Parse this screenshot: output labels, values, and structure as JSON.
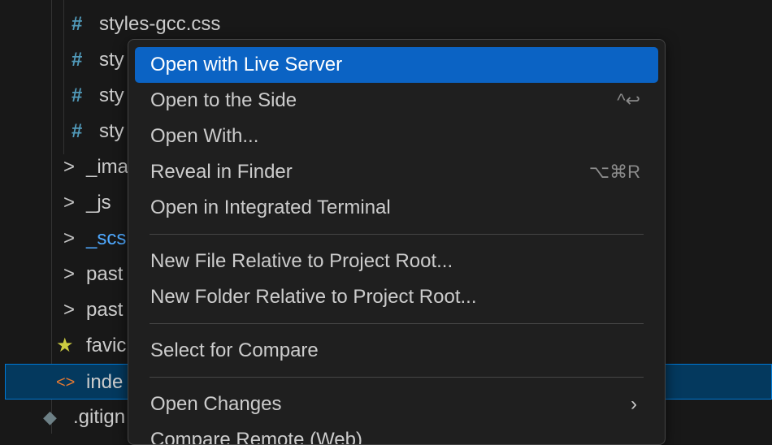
{
  "explorer": {
    "rows": [
      {
        "icon": "#",
        "label": "styles-gcc.css"
      },
      {
        "icon": "#",
        "label": "sty"
      },
      {
        "icon": "#",
        "label": "sty"
      },
      {
        "icon": "#",
        "label": "sty"
      },
      {
        "icon": ">",
        "label": "_ima"
      },
      {
        "icon": ">",
        "label": "_js"
      },
      {
        "icon": ">",
        "label": "_scs"
      },
      {
        "icon": ">",
        "label": "past"
      },
      {
        "icon": ">",
        "label": "past"
      },
      {
        "icon": "★",
        "label": "favic"
      },
      {
        "icon": "<>",
        "label": "inde"
      },
      {
        "icon": "◆",
        "label": ".gitign"
      }
    ]
  },
  "context_menu": {
    "items": [
      {
        "label": "Open with Live Server"
      },
      {
        "label": "Open to the Side",
        "shortcut": "^↩"
      },
      {
        "label": "Open With..."
      },
      {
        "label": "Reveal in Finder",
        "shortcut": "⌥⌘R"
      },
      {
        "label": "Open in Integrated Terminal"
      },
      {
        "label": "New File Relative to Project Root..."
      },
      {
        "label": "New Folder Relative to Project Root..."
      },
      {
        "label": "Select for Compare"
      },
      {
        "label": "Open Changes",
        "submenu": "›"
      },
      {
        "label": "Compare Remote (Web)"
      }
    ]
  },
  "colors": {
    "menu_highlight": "#0b63c4",
    "selection": "#04395e",
    "selection_border": "#0078d4",
    "css_icon": "#519aba",
    "favicon_star": "#cbcb41",
    "html_icon": "#e37933"
  }
}
